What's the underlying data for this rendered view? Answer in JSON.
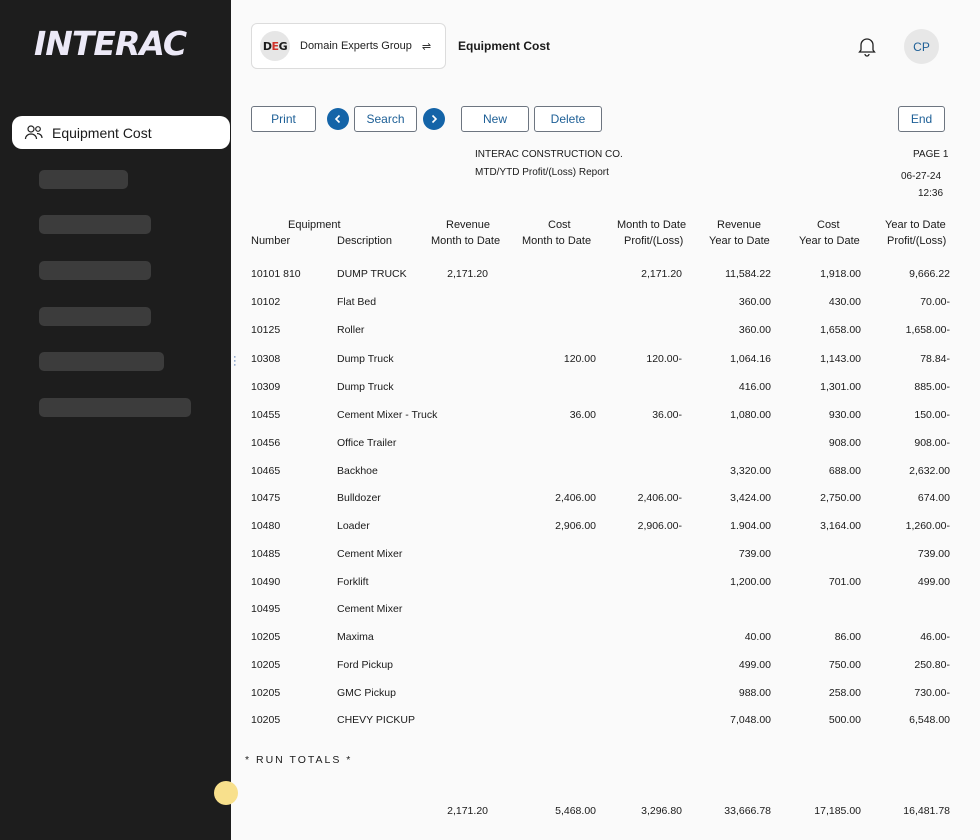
{
  "sidebar": {
    "logo": "INTERAC",
    "active_item": {
      "label": "Equipment Cost",
      "icon": "users-icon"
    }
  },
  "header": {
    "org_logo": {
      "d": "D",
      "e": "E",
      "g": "G"
    },
    "org_name": "Domain Experts Group",
    "switch_icon": "⇌",
    "page_title": "Equipment Cost",
    "avatar_initials": "CP"
  },
  "toolbar": {
    "print": "Print",
    "search": "Search",
    "new": "New",
    "delete": "Delete",
    "end": "End"
  },
  "report": {
    "company": "INTERAC CONSTRUCTION CO.",
    "subtitle": "MTD/YTD Profit/(Loss) Report",
    "page": "PAGE 1",
    "date": "06-27-24",
    "time": "12:36"
  },
  "table": {
    "group_header": "Equipment",
    "headers": {
      "number": "Number",
      "description": "Description",
      "rev_mtd": [
        "Revenue",
        "Month to Date"
      ],
      "cost_mtd": [
        "Cost",
        "Month to Date"
      ],
      "pl_mtd": [
        "Month to Date",
        "Profit/(Loss)"
      ],
      "rev_ytd": [
        "Revenue",
        "Year to Date"
      ],
      "cost_ytd": [
        "Cost",
        "Year to Date"
      ],
      "pl_ytd": [
        "Year to Date",
        "Profit/(Loss)"
      ]
    },
    "rows": [
      {
        "number": "10101 810",
        "description": "DUMP TRUCK",
        "rev_mtd": "2,171.20",
        "cost_mtd": "",
        "pl_mtd": "2,171.20",
        "rev_ytd": "11,584.22",
        "cost_ytd": "1,918.00",
        "pl_ytd": "9,666.22"
      },
      {
        "number": "10102",
        "description": "Flat Bed",
        "rev_mtd": "",
        "cost_mtd": "",
        "pl_mtd": "",
        "rev_ytd": "360.00",
        "cost_ytd": "430.00",
        "pl_ytd": "70.00-"
      },
      {
        "number": "10125",
        "description": "Roller",
        "rev_mtd": "",
        "cost_mtd": "",
        "pl_mtd": "",
        "rev_ytd": "360.00",
        "cost_ytd": "1,658.00",
        "pl_ytd": "1,658.00-"
      },
      {
        "number": "10308",
        "description": "Dump Truck",
        "rev_mtd": "",
        "cost_mtd": "120.00",
        "pl_mtd": "120.00-",
        "rev_ytd": "1,064.16",
        "cost_ytd": "1,143.00",
        "pl_ytd": "78.84-"
      },
      {
        "number": "10309",
        "description": "Dump Truck",
        "rev_mtd": "",
        "cost_mtd": "",
        "pl_mtd": "",
        "rev_ytd": "416.00",
        "cost_ytd": "1,301.00",
        "pl_ytd": "885.00-"
      },
      {
        "number": "10455",
        "description": "Cement Mixer - Truck",
        "rev_mtd": "",
        "cost_mtd": "36.00",
        "pl_mtd": "36.00-",
        "rev_ytd": "1,080.00",
        "cost_ytd": "930.00",
        "pl_ytd": "150.00-"
      },
      {
        "number": "10456",
        "description": "Office Trailer",
        "rev_mtd": "",
        "cost_mtd": "",
        "pl_mtd": "",
        "rev_ytd": "",
        "cost_ytd": "908.00",
        "pl_ytd": "908.00-"
      },
      {
        "number": "10465",
        "description": "Backhoe",
        "rev_mtd": "",
        "cost_mtd": "",
        "pl_mtd": "",
        "rev_ytd": "3,320.00",
        "cost_ytd": "688.00",
        "pl_ytd": "2,632.00"
      },
      {
        "number": "10475",
        "description": "Bulldozer",
        "rev_mtd": "",
        "cost_mtd": "2,406.00",
        "pl_mtd": "2,406.00-",
        "rev_ytd": "3,424.00",
        "cost_ytd": "2,750.00",
        "pl_ytd": "674.00"
      },
      {
        "number": "10480",
        "description": "Loader",
        "rev_mtd": "",
        "cost_mtd": "2,906.00",
        "pl_mtd": "2,906.00-",
        "rev_ytd": "1.904.00",
        "cost_ytd": "3,164.00",
        "pl_ytd": "1,260.00-"
      },
      {
        "number": "10485",
        "description": "Cement Mixer",
        "rev_mtd": "",
        "cost_mtd": "",
        "pl_mtd": "",
        "rev_ytd": "739.00",
        "cost_ytd": "",
        "pl_ytd": "739.00"
      },
      {
        "number": "10490",
        "description": "Forklift",
        "rev_mtd": "",
        "cost_mtd": "",
        "pl_mtd": "",
        "rev_ytd": "1,200.00",
        "cost_ytd": "701.00",
        "pl_ytd": "499.00"
      },
      {
        "number": "10495",
        "description": "Cement Mixer",
        "rev_mtd": "",
        "cost_mtd": "",
        "pl_mtd": "",
        "rev_ytd": "",
        "cost_ytd": "",
        "pl_ytd": ""
      },
      {
        "number": "10205",
        "description": "Maxima",
        "rev_mtd": "",
        "cost_mtd": "",
        "pl_mtd": "",
        "rev_ytd": "40.00",
        "cost_ytd": "86.00",
        "pl_ytd": "46.00-"
      },
      {
        "number": "10205",
        "description": "Ford Pickup",
        "rev_mtd": "",
        "cost_mtd": "",
        "pl_mtd": "",
        "rev_ytd": "499.00",
        "cost_ytd": "750.00",
        "pl_ytd": "250.80-"
      },
      {
        "number": "10205",
        "description": "GMC Pickup",
        "rev_mtd": "",
        "cost_mtd": "",
        "pl_mtd": "",
        "rev_ytd": "988.00",
        "cost_ytd": "258.00",
        "pl_ytd": "730.00-"
      },
      {
        "number": "10205",
        "description": "CHEVY PICKUP",
        "rev_mtd": "",
        "cost_mtd": "",
        "pl_mtd": "",
        "rev_ytd": "7,048.00",
        "cost_ytd": "500.00",
        "pl_ytd": "6,548.00"
      }
    ],
    "run_totals_label": "* RUN TOTALS *",
    "totals": {
      "rev_mtd": "2,171.20",
      "cost_mtd": "5,468.00",
      "pl_mtd": "3,296.80",
      "rev_ytd": "33,666.78",
      "cost_ytd": "17,185.00",
      "pl_ytd": "16,481.78"
    }
  }
}
